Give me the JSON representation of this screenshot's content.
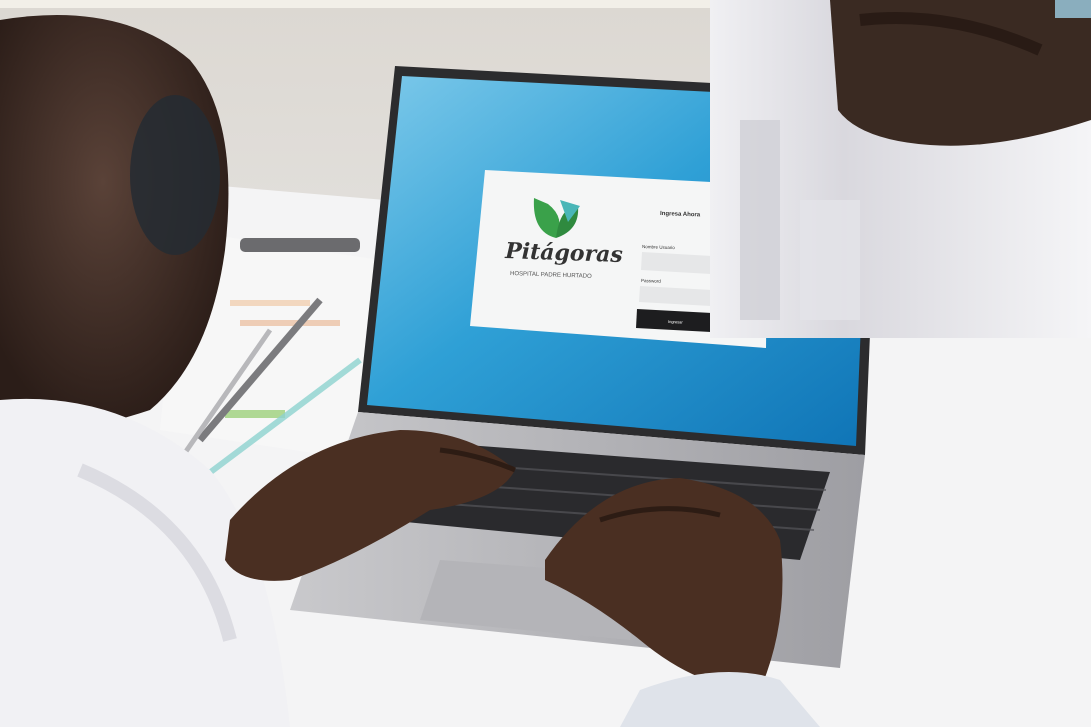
{
  "photo": {
    "login_card": {
      "brand_name": "Pitágoras",
      "brand_subtitle": "HOSPITAL PADRE HURTADO",
      "heading": "Ingresa Ahora",
      "user_label": "Nombre Usuario",
      "password_label": "Password",
      "button_label": "Ingresar"
    },
    "colors": {
      "screen_blue": "#2f9fd4",
      "logo_green": "#3aa14a",
      "logo_teal": "#49b6b7",
      "skin": "#4a2f22",
      "shirt": "#f1f1f4"
    }
  }
}
